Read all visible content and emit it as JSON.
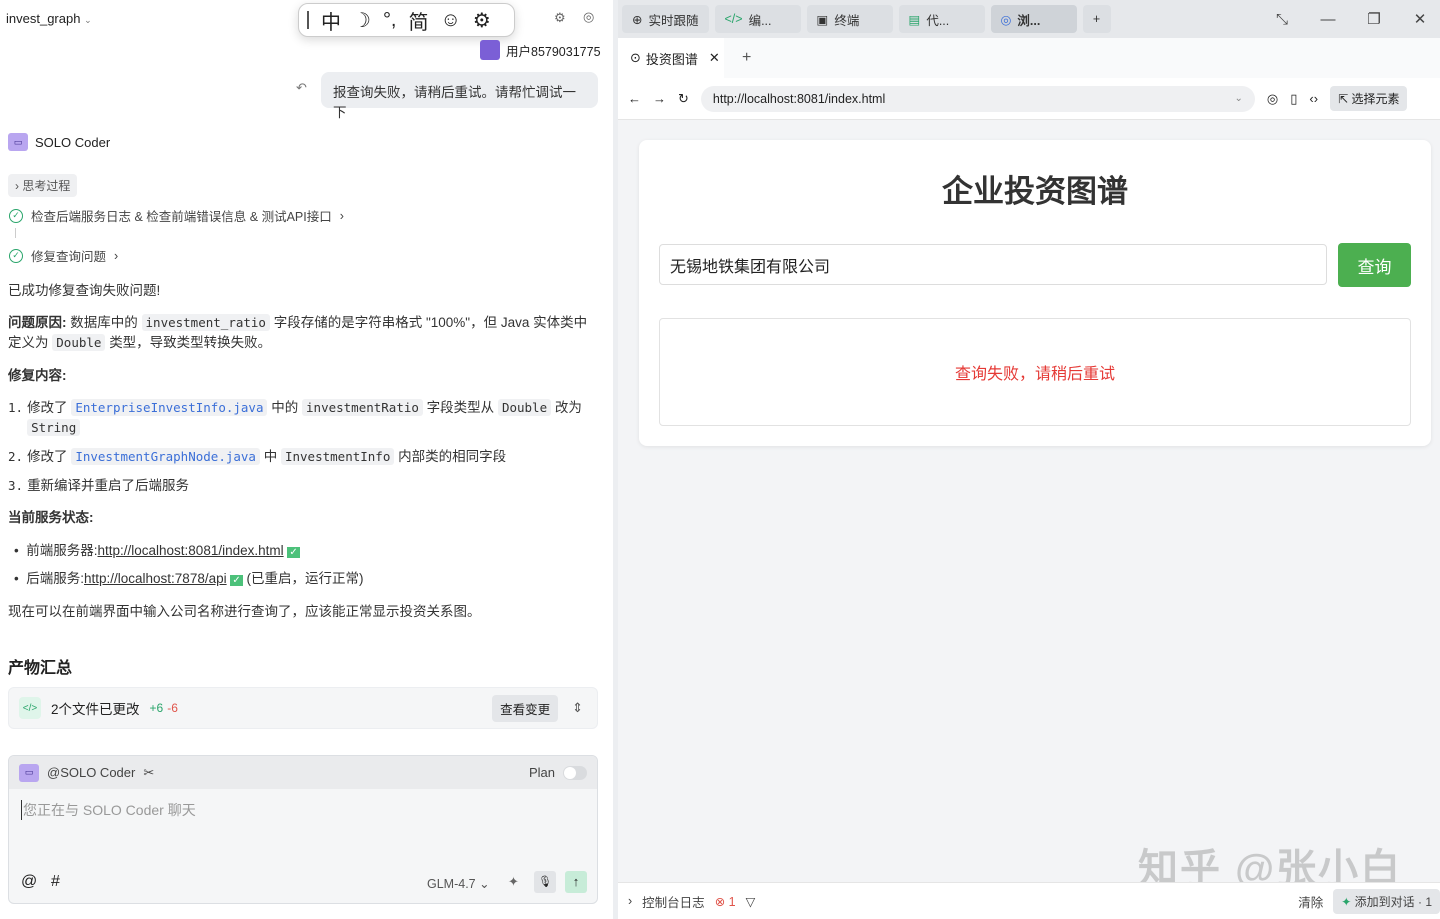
{
  "left": {
    "project": "invest_graph",
    "ime": {
      "mode": "中",
      "punct": "°,",
      "script": "简"
    },
    "user": "用户8579031775",
    "user_message": "报查询失败，请稍后重试。请帮忙调试一下",
    "agent_name": "SOLO Coder",
    "thinking": "思考过程",
    "steps": [
      "检查后端服务日志 & 检查前端错误信息 & 测试API接口",
      "修复查询问题"
    ],
    "success": "已成功修复查询失败问题!",
    "cause": {
      "label": "问题原因:",
      "t1": "数据库中的",
      "code1": "investment_ratio",
      "t2": "字段存储的是字符串格式 \"100%\"，但 Java 实体类中定义为",
      "code2": "Double",
      "t3": "类型，导致类型转换失败。"
    },
    "fix_heading": "修复内容:",
    "fixes": [
      {
        "n": "1.",
        "t1": "修改了",
        "file": "EnterpriseInvestInfo.java",
        "t2": "中的",
        "c1": "investmentRatio",
        "t3": "字段类型从",
        "c2": "Double",
        "t4": "改为",
        "c3": "String"
      },
      {
        "n": "2.",
        "t1": "修改了",
        "file": "InvestmentGraphNode.java",
        "t2": "中",
        "c1": "InvestmentInfo",
        "t3": "内部类的相同字段"
      },
      {
        "n": "3.",
        "t1": "重新编译并重启了后端服务"
      }
    ],
    "status_heading": "当前服务状态:",
    "status": [
      {
        "label": "前端服务器:",
        "url": "http://localhost:8081/index.html",
        "note": ""
      },
      {
        "label": "后端服务:",
        "url": "http://localhost:7878/api",
        "note": "(已重启，运行正常)"
      }
    ],
    "conclusion": "现在可以在前端界面中输入公司名称进行查询了，应该能正常显示投资关系图。",
    "artifacts_heading": "产物汇总",
    "files_changed": "2个文件已更改",
    "added": "+6",
    "removed": "-6",
    "view_changes": "查看变更",
    "chat": {
      "agent": "@SOLO Coder",
      "plan": "Plan",
      "placeholder": "您正在与 SOLO Coder 聊天",
      "model": "GLM-4.7"
    }
  },
  "right": {
    "tabs": [
      "实时跟随",
      "编...",
      "终端",
      "代...",
      "浏..."
    ],
    "browser_tab": "投资图谱",
    "url": "http://localhost:8081/index.html",
    "select_element": "选择元素",
    "page": {
      "title": "企业投资图谱",
      "search_value": "无锡地铁集团有限公司",
      "query_button": "查询",
      "error": "查询失败，请稍后重试"
    },
    "console": {
      "label": "控制台日志",
      "errors": "1",
      "clear": "清除",
      "add": "添加到对话 · 1"
    }
  },
  "watermark": "知乎 @张小白"
}
